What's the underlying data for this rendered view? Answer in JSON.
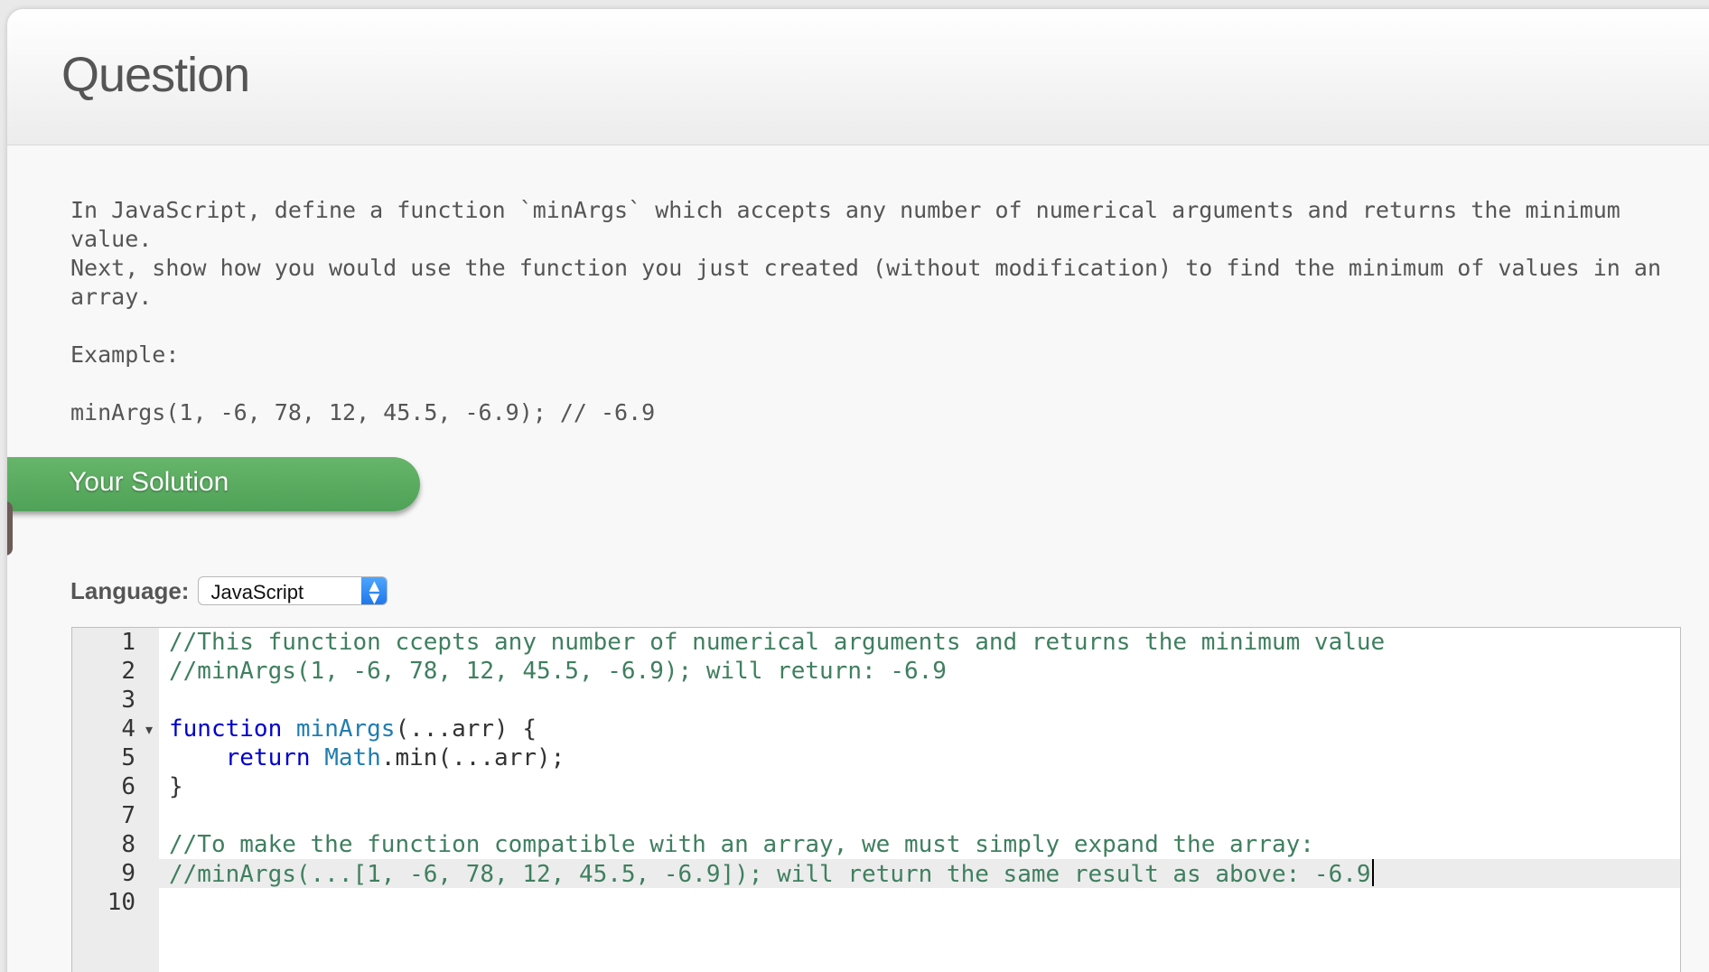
{
  "header": {
    "title": "Question"
  },
  "question": {
    "text": "In JavaScript, define a function `minArgs` which accepts any number of numerical arguments and returns the minimum value.\nNext, show how you would use the function you just created (without modification) to find the minimum of values in an array.\n\nExample:\n\nminArgs(1, -6, 78, 12, 45.5, -6.9); // -6.9"
  },
  "solution": {
    "label": "Your Solution"
  },
  "language": {
    "label": "Language:",
    "selected": "JavaScript",
    "arrow_icon": "select-updown-icon"
  },
  "editor": {
    "line_numbers": [
      "1",
      "2",
      "3",
      "4",
      "5",
      "6",
      "7",
      "8",
      "9",
      "10"
    ],
    "fold_icon": "▾",
    "active_line": 9,
    "lines": [
      [
        {
          "cls": "comment",
          "text": "//This function ccepts any number of numerical arguments and returns the minimum value"
        }
      ],
      [
        {
          "cls": "comment",
          "text": "//minArgs(1, -6, 78, 12, 45.5, -6.9); will return: -6.9"
        }
      ],
      [],
      [
        {
          "cls": "keyword",
          "text": "function "
        },
        {
          "cls": "builtin",
          "text": "minArgs"
        },
        {
          "cls": "punct",
          "text": "(...arr) {"
        }
      ],
      [
        {
          "cls": "punct",
          "text": "    "
        },
        {
          "cls": "keyword",
          "text": "return "
        },
        {
          "cls": "builtin",
          "text": "Math"
        },
        {
          "cls": "punct",
          "text": ".min(...arr);"
        }
      ],
      [
        {
          "cls": "punct",
          "text": "}"
        }
      ],
      [],
      [
        {
          "cls": "comment",
          "text": "//To make the function compatible with an array, we must simply expand the array:"
        }
      ],
      [
        {
          "cls": "comment",
          "text": "//minArgs(...[1, -6, 78, 12, 45.5, -6.9]); will return the same result as above: -6.9"
        }
      ],
      []
    ]
  }
}
